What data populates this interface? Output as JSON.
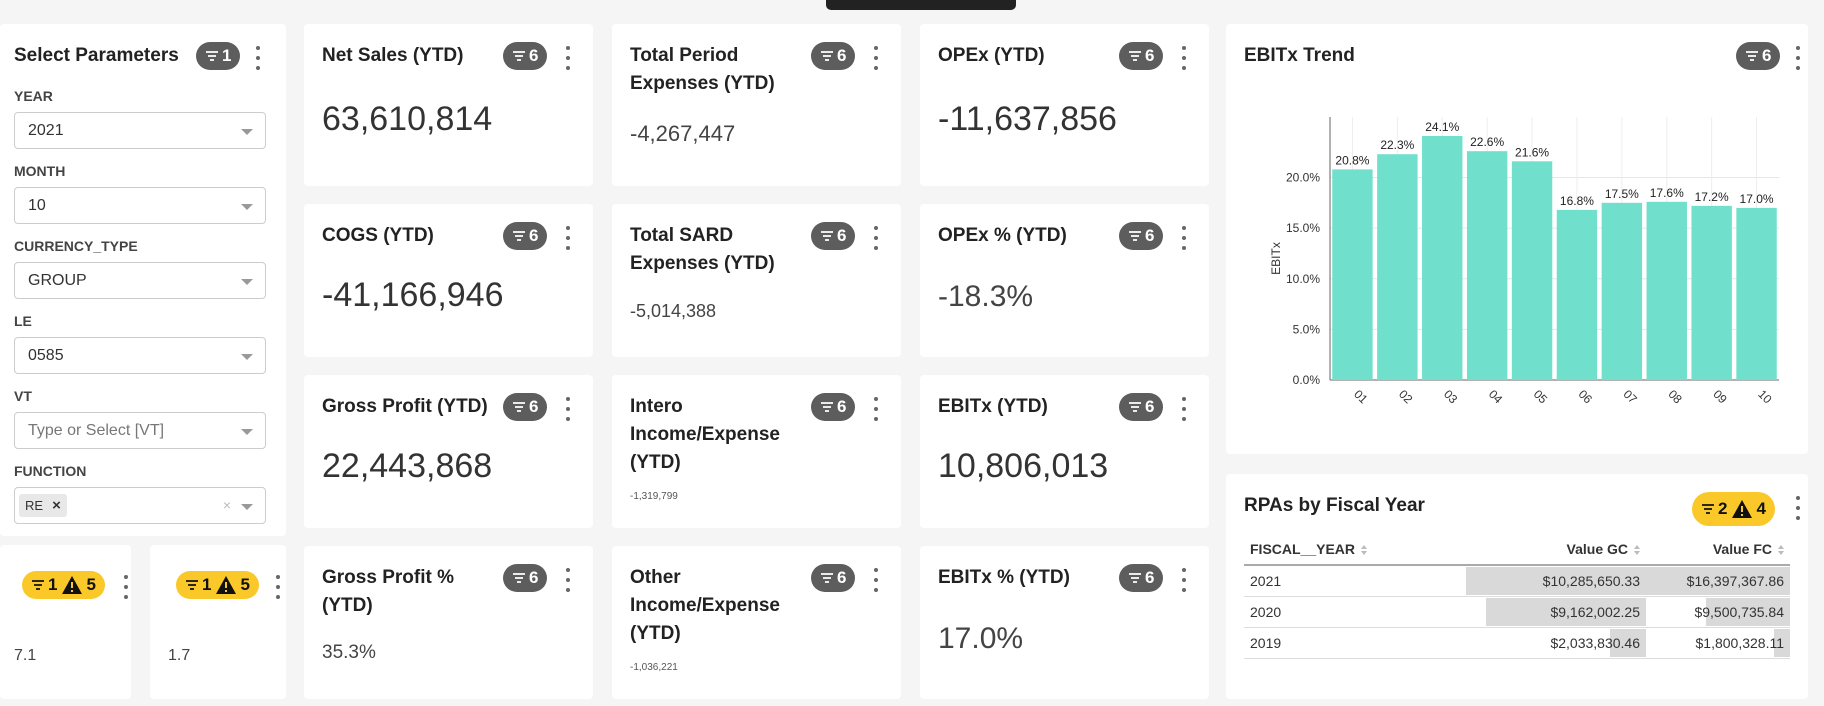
{
  "params": {
    "title": "Select Parameters",
    "filter_count": "1",
    "fields": [
      {
        "label": "YEAR",
        "value": "2021"
      },
      {
        "label": "MONTH",
        "value": "10"
      },
      {
        "label": "CURRENCY_TYPE",
        "value": "GROUP"
      },
      {
        "label": "LE",
        "value": "0585"
      },
      {
        "label": "VT",
        "placeholder": "Type or Select [VT]"
      },
      {
        "label": "FUNCTION",
        "tag": "RE"
      }
    ]
  },
  "mini_cards": [
    {
      "filter_count": "1",
      "warn_count": "5",
      "value": "7.1"
    },
    {
      "filter_count": "1",
      "warn_count": "5",
      "value": "1.7"
    }
  ],
  "kpis": [
    {
      "title": "Net Sales (YTD)",
      "value": "63,610,814",
      "badge": "6"
    },
    {
      "title": "Total Period Expenses (YTD)",
      "value": "-4,267,447",
      "badge": "6"
    },
    {
      "title": "OPEx (YTD)",
      "value": "-11,637,856",
      "badge": "6"
    },
    {
      "title": "COGS (YTD)",
      "value": "-41,166,946",
      "badge": "6"
    },
    {
      "title": "Total SARD Expenses (YTD)",
      "value": "-5,014,388",
      "badge": "6"
    },
    {
      "title": "OPEx % (YTD)",
      "value": "-18.3%",
      "badge": "6"
    },
    {
      "title": "Gross Profit (YTD)",
      "value": "22,443,868",
      "badge": "6"
    },
    {
      "title": "Intero Income/Expense (YTD)",
      "value": "-1,319,799",
      "badge": "6"
    },
    {
      "title": "EBITx (YTD)",
      "value": "10,806,013",
      "badge": "6"
    },
    {
      "title": "Gross Profit % (YTD)",
      "value": "35.3%",
      "badge": "6"
    },
    {
      "title": "Other Income/Expense (YTD)",
      "value": "-1,036,221",
      "badge": "6"
    },
    {
      "title": "EBITx % (YTD)",
      "value": "17.0%",
      "badge": "6"
    }
  ],
  "ebitx_trend": {
    "title": "EBITx Trend",
    "badge": "6"
  },
  "chart_data": {
    "type": "bar",
    "title": "EBITx Trend",
    "categories": [
      "01",
      "02",
      "03",
      "04",
      "05",
      "06",
      "07",
      "08",
      "09",
      "10"
    ],
    "values": [
      20.8,
      22.3,
      24.1,
      22.6,
      21.6,
      16.8,
      17.5,
      17.6,
      17.2,
      17.0
    ],
    "data_labels": [
      "20.8%",
      "22.3%",
      "24.1%",
      "22.6%",
      "21.6%",
      "16.8%",
      "17.5%",
      "17.6%",
      "17.2%",
      "17.0%"
    ],
    "ylabel": "EBITx",
    "yticks": [
      "0.0%",
      "5.0%",
      "10.0%",
      "15.0%",
      "20.0%"
    ],
    "ylim": [
      0,
      24
    ],
    "bar_color": "#70e0cd",
    "grid": true
  },
  "rpa": {
    "title": "RPAs by Fiscal Year",
    "filter_count": "2",
    "warn_count": "4",
    "columns": [
      "FISCAL__YEAR",
      "Value GC",
      "Value FC"
    ],
    "rows": [
      {
        "year": "2021",
        "gc": "$10,285,650.33",
        "fc": "$16,397,367.86",
        "gc_frac": 1.0,
        "fc_frac": 1.0
      },
      {
        "year": "2020",
        "gc": "$9,162,002.25",
        "fc": "$9,500,735.84",
        "gc_frac": 0.89,
        "fc_frac": 0.58
      },
      {
        "year": "2019",
        "gc": "$2,033,830.46",
        "fc": "$1,800,328.11",
        "gc_frac": 0.2,
        "fc_frac": 0.11
      }
    ]
  }
}
